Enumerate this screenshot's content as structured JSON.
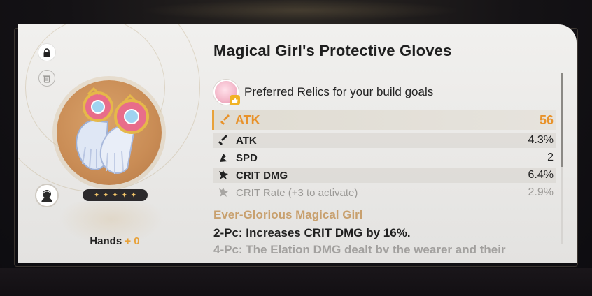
{
  "relic": {
    "name": "Magical Girl's Protective Gloves",
    "slot": "Hands",
    "level": "+ 0",
    "rarity_stars": [
      "✦",
      "✦",
      "✦",
      "✦",
      "✦"
    ]
  },
  "preferred": {
    "text": "Preferred Relics for your build goals"
  },
  "main_stat": {
    "name": "ATK",
    "value": "56",
    "icon": "atk-sword-icon"
  },
  "sub_stats": [
    {
      "name": "ATK",
      "value": "4.3%",
      "icon": "atk-sword-icon"
    },
    {
      "name": "SPD",
      "value": "2",
      "icon": "spd-boot-icon"
    },
    {
      "name": "CRIT DMG",
      "value": "6.4%",
      "icon": "crit-dmg-icon"
    },
    {
      "name": "CRIT Rate (+3 to activate)",
      "value": "2.9%",
      "icon": "crit-rate-icon"
    }
  ],
  "set": {
    "name": "Ever-Glorious Magical Girl",
    "two_piece": "2-Pc: Increases CRIT DMG by 16%.",
    "four_piece": "4-Pc: The Elation DMG dealt by the wearer and their"
  },
  "colors": {
    "accent": "#e8a23a",
    "text_dark": "#1f1f1f",
    "set_name": "#c8a06e",
    "card_bg": "#efeeec"
  }
}
